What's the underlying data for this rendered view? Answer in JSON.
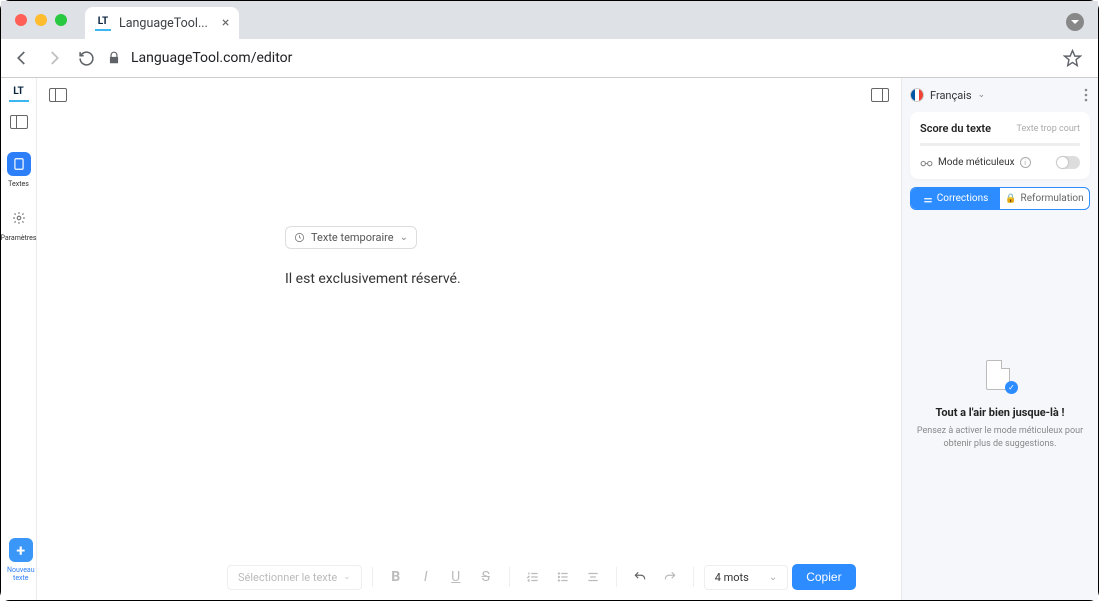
{
  "browser": {
    "tab_title": "LanguageTool...",
    "url": "LanguageTool.com/editor"
  },
  "leftbar": {
    "logo": "LT",
    "textes_label": "Textes",
    "params_label": "Paramètres",
    "new_label": "Nouveau\ntexte"
  },
  "editor": {
    "temp_chip": "Texte temporaire",
    "body_text": "Il est exclusivement réservé."
  },
  "bottombar": {
    "select_label": "Sélectionner le texte",
    "word_count": "4 mots",
    "copy_label": "Copier"
  },
  "right": {
    "language": "Français",
    "score_title": "Score du texte",
    "score_msg": "Texte trop court",
    "meticulous_label": "Mode méticuleux",
    "tab_corrections": "Corrections",
    "tab_reformulation": "Reformulation",
    "empty_title": "Tout a l'air bien jusque-là !",
    "empty_sub": "Pensez à activer le mode méticuleux pour obtenir plus de suggestions."
  }
}
